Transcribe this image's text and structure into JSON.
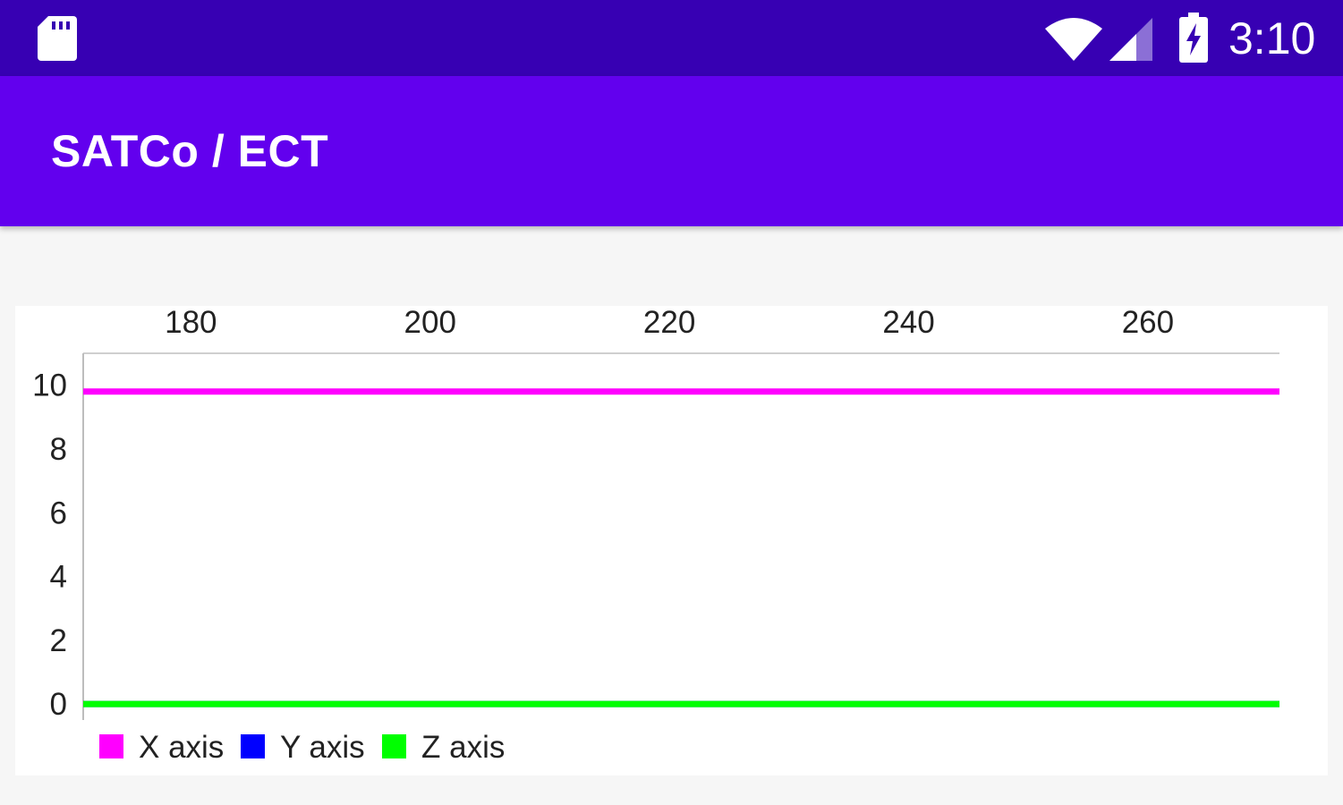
{
  "status_bar": {
    "time": "3:10",
    "icons": [
      "sd-card-icon",
      "wifi-icon",
      "signal-icon",
      "battery-charging-icon"
    ],
    "background": "#3700b3"
  },
  "app_bar": {
    "title": "SATCo / ECT",
    "background": "#6200ee"
  },
  "chart_data": {
    "type": "line",
    "x_ticks": [
      180,
      200,
      220,
      240,
      260
    ],
    "y_ticks": [
      0,
      2,
      4,
      6,
      8,
      10
    ],
    "xlim": [
      171,
      271
    ],
    "ylim": [
      -0.5,
      11
    ],
    "x_axis_position": "top",
    "grid": false,
    "legend_position": "bottom-left",
    "series": [
      {
        "name": "X axis",
        "color": "#ff00ff",
        "x": [
          171,
          271
        ],
        "y": [
          9.8,
          9.8
        ]
      },
      {
        "name": "Y axis",
        "color": "#0000ff",
        "x": [
          171,
          271
        ],
        "y": [
          0,
          0
        ]
      },
      {
        "name": "Z axis",
        "color": "#00ff00",
        "x": [
          171,
          271
        ],
        "y": [
          0,
          0
        ]
      }
    ]
  }
}
